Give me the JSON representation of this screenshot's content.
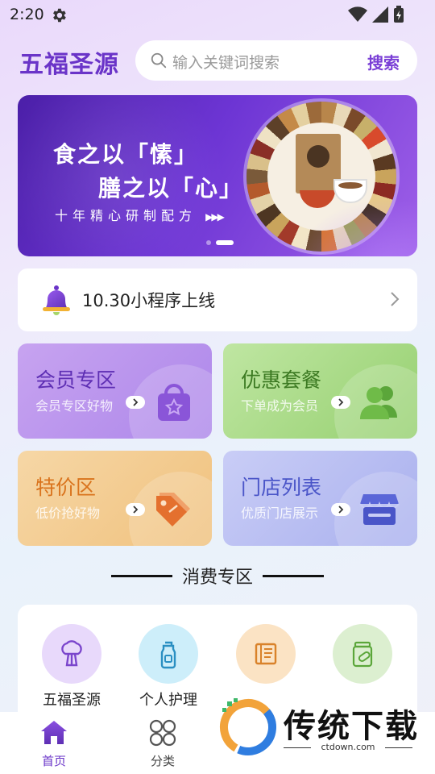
{
  "status_bar": {
    "time": "2:20"
  },
  "header": {
    "brand": "五福圣源",
    "search": {
      "placeholder": "输入关键词搜索",
      "button": "搜索"
    }
  },
  "banner": {
    "line1": "食之以「愫」",
    "line2": "膳之以「心」",
    "subtitle": "十年精心研制配方",
    "slide_count": 2,
    "active_slide": 2
  },
  "notice": {
    "text": "10.30小程序上线"
  },
  "cards": [
    {
      "title": "会员专区",
      "subtitle": "会员专区好物",
      "icon": "shopping-bag-icon",
      "color": "#5e2fb4"
    },
    {
      "title": "优惠套餐",
      "subtitle": "下单成为会员",
      "icon": "users-icon",
      "color": "#3c7a22"
    },
    {
      "title": "特价区",
      "subtitle": "低价抢好物",
      "icon": "price-tag-icon",
      "color": "#d9731c"
    },
    {
      "title": "门店列表",
      "subtitle": "优质门店展示",
      "icon": "store-icon",
      "color": "#4a55c8"
    }
  ],
  "section": {
    "title": "消费专区"
  },
  "categories": [
    {
      "label": "五福圣源",
      "icon": "broccoli-icon"
    },
    {
      "label": "个人护理",
      "icon": "bottle-icon"
    },
    {
      "label": "",
      "icon": "book-icon"
    },
    {
      "label": "",
      "icon": "medicine-jar-icon"
    }
  ],
  "bottom_nav": [
    {
      "label": "首页",
      "icon": "home-icon",
      "active": true
    },
    {
      "label": "分类",
      "icon": "grid-icon",
      "active": false
    }
  ],
  "watermark": {
    "text": "传统下载",
    "url": "ctdown.com"
  },
  "colors": {
    "accent": "#7a3fd6",
    "brand": "#6a34c8"
  }
}
